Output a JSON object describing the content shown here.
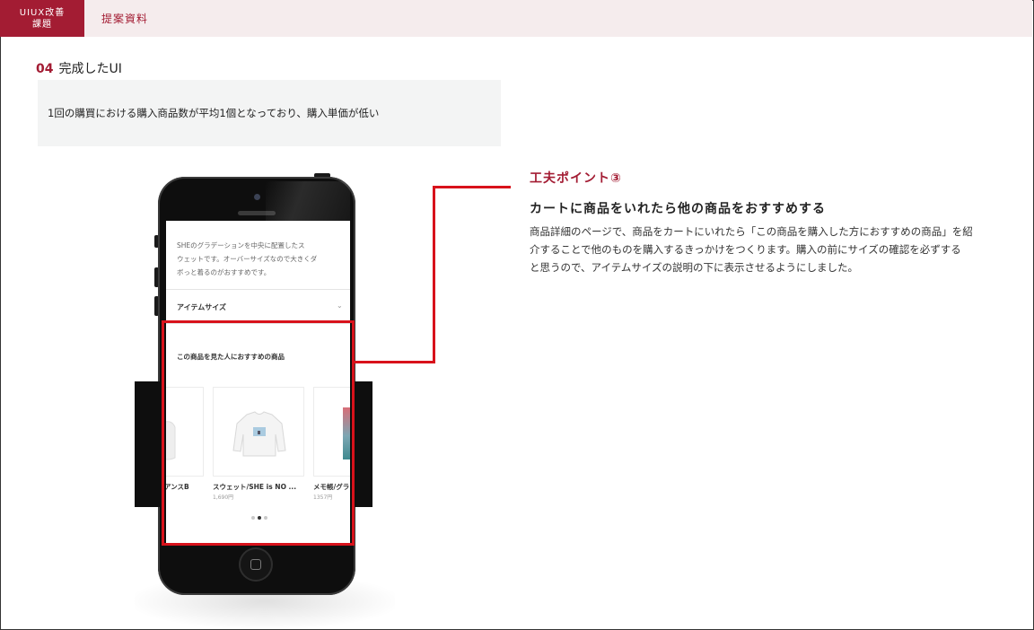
{
  "header": {
    "badge_line1": "UIUX改善",
    "badge_line2": "課題",
    "tab_label": "提案資料"
  },
  "section": {
    "number": "04",
    "title": "完成したUI",
    "problem_text": "1回の購買における購入商品数が平均1個となっており、購入単価が低い"
  },
  "phone_screen": {
    "description_lines": [
      "SHEのグラデーションを中央に配置したス",
      "ウェットです。オーバーサイズなので大きくダ",
      "ボっと着るのがおすすめです。"
    ],
    "item_size_label": "アイテムサイズ",
    "chevron_glyph": "⌄",
    "recommend_title": "この商品を見た人におすすめの商品",
    "products": [
      {
        "name": "アンスB",
        "price": ""
      },
      {
        "name": "スウェット/SHE is NO ...",
        "price": "1,690円"
      },
      {
        "name": "メモ帳/グラ",
        "price": "1357円"
      }
    ],
    "carousel_active_index": 1
  },
  "point": {
    "label": "工夫ポイント③",
    "heading": "カートに商品をいれたら他の商品をおすすめする",
    "body_lines": [
      "商品詳細のページで、商品をカートにいれたら「この商品を購入した方におすすめの商品」を紹",
      "介することで他のものを購入するきっかけをつくります。購入の前にサイズの確認を必ずする",
      "と思うので、アイテムサイズの説明の下に表示させるようにしました。"
    ]
  },
  "colors": {
    "accent": "#a31c33",
    "highlight": "#d8121b",
    "header_bg": "#f5eced",
    "problem_bg": "#f3f4f4"
  }
}
